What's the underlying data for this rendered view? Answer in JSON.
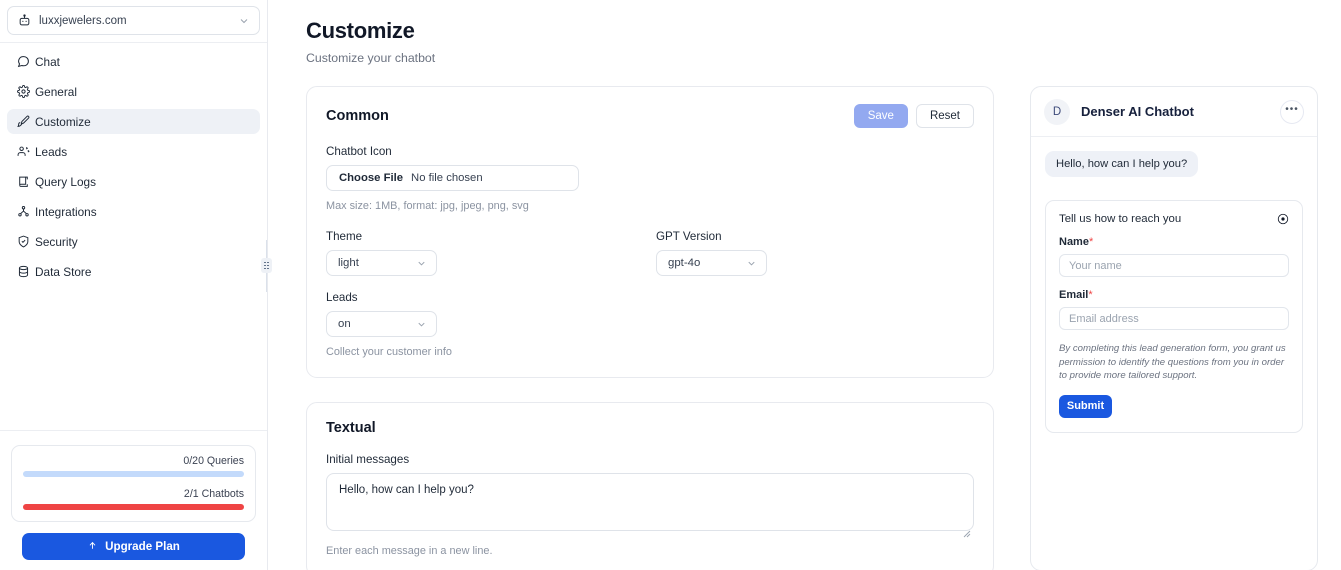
{
  "sidebar": {
    "site_selector": {
      "label": "luxxjewelers.com",
      "icon": "robot-icon",
      "chevron": "chevron-down-icon"
    },
    "items": [
      {
        "label": "Chat",
        "icon": "chat-bubble-icon",
        "active": false
      },
      {
        "label": "General",
        "icon": "gear-icon",
        "active": false
      },
      {
        "label": "Customize",
        "icon": "paintbrush-icon",
        "active": true
      },
      {
        "label": "Leads",
        "icon": "users-icon",
        "active": false
      },
      {
        "label": "Query Logs",
        "icon": "scroll-icon",
        "active": false
      },
      {
        "label": "Integrations",
        "icon": "network-icon",
        "active": false
      },
      {
        "label": "Security",
        "icon": "shield-check-icon",
        "active": false
      },
      {
        "label": "Data Store",
        "icon": "database-icon",
        "active": false
      }
    ],
    "usage": {
      "queries_label": "0/20 Queries",
      "queries_percent": 0,
      "queries_color": "#c3dafb",
      "chatbots_label": "2/1 Chatbots",
      "chatbots_percent": 100,
      "chatbots_color": "#ef4444"
    },
    "upgrade_button": {
      "label": "Upgrade Plan",
      "icon": "upgrade-arrow-icon",
      "color": "#1a58e0"
    }
  },
  "main": {
    "title": "Customize",
    "subtitle": "Customize your chatbot",
    "common_card": {
      "title": "Common",
      "save_label": "Save",
      "reset_label": "Reset",
      "save_color": "#93a9f0",
      "chatbot_icon_label": "Chatbot Icon",
      "choose_file_label": "Choose File",
      "no_file_label": "No file chosen",
      "file_hint": "Max size: 1MB, format: jpg, jpeg, png, svg",
      "theme_label": "Theme",
      "theme_value": "light",
      "gpt_label": "GPT Version",
      "gpt_value": "gpt-4o",
      "leads_label": "Leads",
      "leads_value": "on",
      "leads_hint": "Collect your customer info"
    },
    "textual_card": {
      "title": "Textual",
      "initial_messages_label": "Initial messages",
      "initial_messages_value": "Hello, how can I help you?",
      "initial_messages_hint": "Enter each message in a new line."
    }
  },
  "preview": {
    "avatar_letter": "D",
    "name": "Denser AI Chatbot",
    "menu_icon": "ellipsis-icon",
    "greeting": "Hello, how can I help you?",
    "lead_form": {
      "title": "Tell us how to reach you",
      "close_icon": "close-circle-icon",
      "name_label": "Name",
      "name_required": "*",
      "name_placeholder": "Your name",
      "email_label": "Email",
      "email_required": "*",
      "email_placeholder": "Email address",
      "legal": "By completing this lead generation form, you grant us permission to identify the questions from you in order to provide more tailored support.",
      "submit_label": "Submit",
      "submit_color": "#1a58e0"
    }
  }
}
